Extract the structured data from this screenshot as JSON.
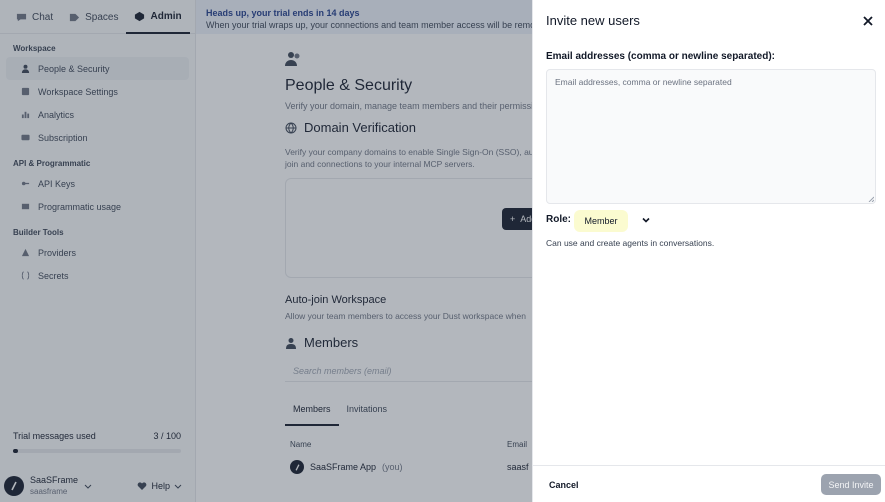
{
  "topnav": {
    "tabs": [
      {
        "label": "Chat",
        "icon": "chat-icon"
      },
      {
        "label": "Spaces",
        "icon": "spaces-icon"
      },
      {
        "label": "Admin",
        "icon": "admin-icon"
      }
    ]
  },
  "sidebar": {
    "sections": [
      {
        "label": "Workspace",
        "items": [
          "People & Security",
          "Workspace Settings",
          "Analytics",
          "Subscription"
        ]
      },
      {
        "label": "API & Programmatic",
        "items": [
          "API Keys",
          "Programmatic usage"
        ]
      },
      {
        "label": "Builder Tools",
        "items": [
          "Providers",
          "Secrets"
        ]
      }
    ],
    "trial_label": "Trial messages used",
    "trial_count": "3 / 100",
    "trial_progress_fraction": 0.03,
    "user_name": "SaaSFrame",
    "user_sub": "saasframe",
    "help_label": "Help"
  },
  "banner": {
    "title": "Heads up, your trial ends in 14 days",
    "text": "When your trial wraps up, your connections and team member access will be removed"
  },
  "main": {
    "page_title": "People & Security",
    "page_desc": "Verify your domain, manage team members and their permissions.",
    "domain_title": "Domain Verification",
    "domain_desc": "Verify your company domains to enable Single Sign-On (SSO), auto-join and connections to your internal MCP servers.",
    "add_label": "Add",
    "autojoin_title": "Auto-join Workspace",
    "autojoin_desc": "Allow your team members to access your Dust workspace when",
    "members_title": "Members",
    "search_placeholder": "Search members (email)",
    "tabs": [
      "Members",
      "Invitations"
    ],
    "col_name": "Name",
    "col_email": "Email",
    "row_name": "SaaSFrame App",
    "row_you": "(you)",
    "row_email": "saasf"
  },
  "dialog": {
    "title": "Invite new users",
    "email_label": "Email addresses (comma or newline separated):",
    "email_placeholder": "Email addresses, comma or newline separated",
    "email_value": "",
    "role_label": "Role:",
    "role_value": "Member",
    "role_desc": "Can use and create agents in conversations.",
    "cancel_label": "Cancel",
    "send_label": "Send Invite"
  }
}
